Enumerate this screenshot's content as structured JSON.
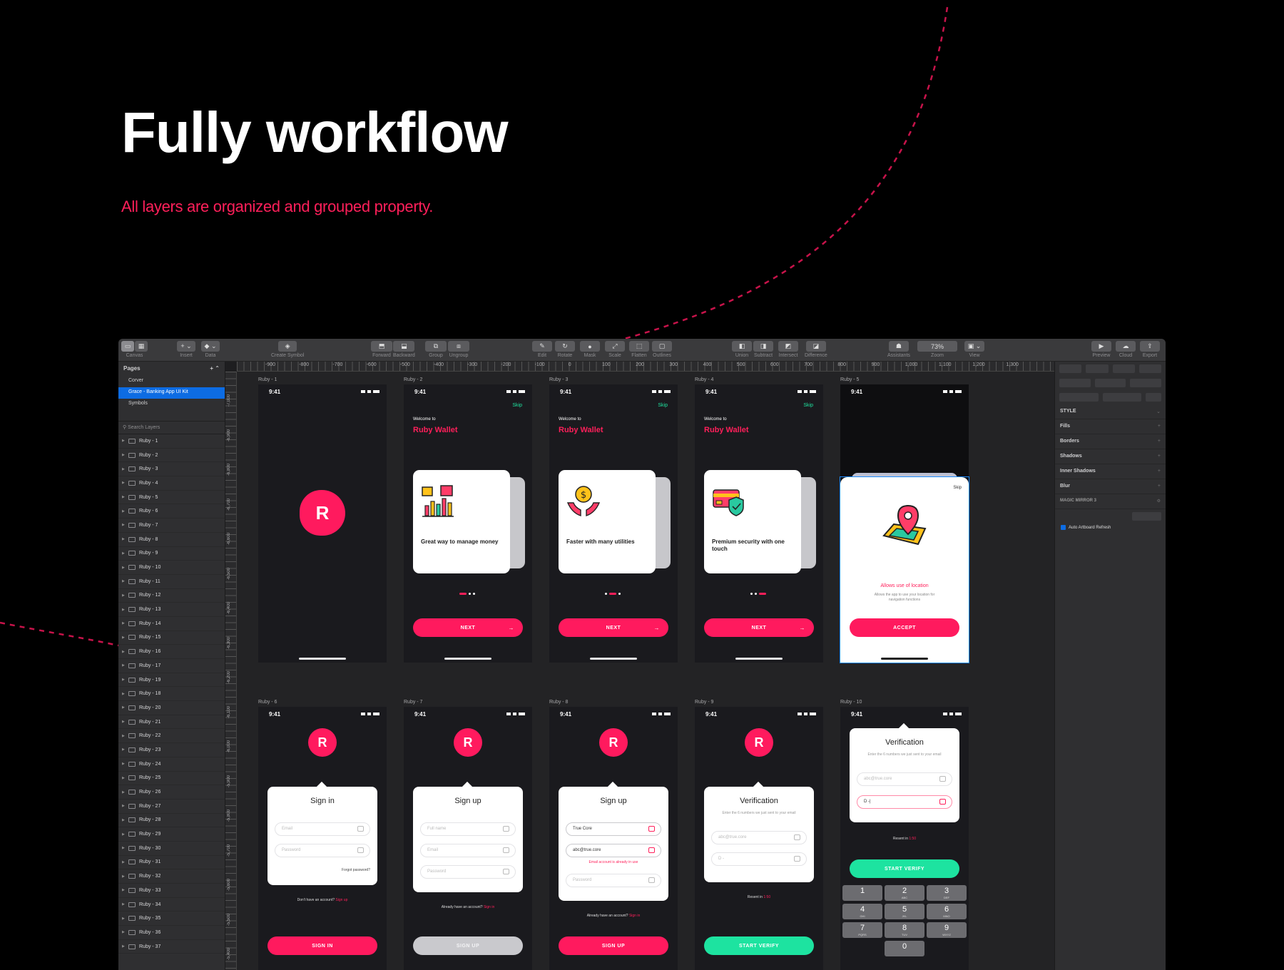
{
  "hero": {
    "title": "Fully workflow",
    "subtitle": "All layers are  organized and grouped property."
  },
  "colors": {
    "accent": "#ff1f5a",
    "green": "#1de3a0",
    "selection": "#0d6ce3"
  },
  "toolbar": {
    "canvas": "Canvas",
    "insert": "Insert",
    "data": "Data",
    "create_symbol": "Create Symbol",
    "forward": "Forward",
    "backward": "Backward",
    "group": "Group",
    "ungroup": "Ungroup",
    "edit": "Edit",
    "rotate": "Rotate",
    "mask": "Mask",
    "scale": "Scale",
    "flatten": "Flatten",
    "outlines": "Outlines",
    "union": "Union",
    "subtract": "Subtract",
    "intersect": "Intersect",
    "difference": "Difference",
    "assistants": "Assistants",
    "zoom_value": "73%",
    "zoom": "Zoom",
    "view": "View",
    "preview": "Preview",
    "cloud": "Cloud",
    "export": "Export"
  },
  "pages": {
    "header": "Pages",
    "items": [
      "Corver",
      "Grace - Banking App UI Kit",
      "Symbols"
    ],
    "selected": 1
  },
  "layers": {
    "search_placeholder": "Search Layers",
    "items": [
      "Ruby - 1",
      "Ruby - 2",
      "Ruby - 3",
      "Ruby - 4",
      "Ruby - 5",
      "Ruby - 6",
      "Ruby - 7",
      "Ruby - 8",
      "Ruby - 9",
      "Ruby - 10",
      "Ruby - 11",
      "Ruby - 12",
      "Ruby - 13",
      "Ruby - 14",
      "Ruby - 15",
      "Ruby - 16",
      "Ruby - 17",
      "Ruby - 19",
      "Ruby - 18",
      "Ruby - 20",
      "Ruby - 21",
      "Ruby - 22",
      "Ruby - 23",
      "Ruby - 24",
      "Ruby - 25",
      "Ruby - 26",
      "Ruby - 27",
      "Ruby - 28",
      "Ruby - 29",
      "Ruby - 30",
      "Ruby - 31",
      "Ruby - 32",
      "Ruby - 33",
      "Ruby - 34",
      "Ruby - 35",
      "Ruby - 36",
      "Ruby - 37"
    ]
  },
  "ruler": {
    "h": [
      "-900",
      "-800",
      "-700",
      "-600",
      "-500",
      "-400",
      "-300",
      "-200",
      "-100",
      "0",
      "100",
      "200",
      "300",
      "400",
      "500",
      "600",
      "700",
      "800",
      "900",
      "1,000",
      "1,100",
      "1,200",
      "1,300"
    ],
    "v": [
      "-7,000",
      "-6,900",
      "-6,800",
      "-6,700",
      "-6,600",
      "-6,500",
      "-6,400",
      "-6,300",
      "-6,200",
      "-6,100",
      "-6,000",
      "-5,900",
      "-5,800",
      "-5,700",
      "-5,600",
      "-5,500",
      "-5,400"
    ]
  },
  "inspector": {
    "style": "STYLE",
    "fills": "Fills",
    "borders": "Borders",
    "shadows": "Shadows",
    "inner_shadows": "Inner Shadows",
    "blur": "Blur",
    "magic_mirror": "MAGIC MIRROR 3",
    "auto_refresh": "Auto Artboard Refresh"
  },
  "artboards": {
    "r1": {
      "name": "Ruby - 1",
      "time": "9:41",
      "logo": "R"
    },
    "r2": {
      "name": "Ruby - 2",
      "time": "9:41",
      "skip": "Skip",
      "welcome": "Welcome to",
      "brand": "Ruby Wallet",
      "card": "Great way to manage money",
      "button": "NEXT",
      "arrow": "→"
    },
    "r3": {
      "name": "Ruby - 3",
      "time": "9:41",
      "skip": "Skip",
      "welcome": "Welcome to",
      "brand": "Ruby Wallet",
      "card": "Faster with many utilities",
      "button": "NEXT",
      "arrow": "→"
    },
    "r4": {
      "name": "Ruby - 4",
      "time": "9:41",
      "skip": "Skip",
      "welcome": "Welcome to",
      "brand": "Ruby Wallet",
      "card": "Premium security with one touch",
      "button": "NEXT",
      "arrow": "→"
    },
    "r5": {
      "name": "Ruby - 5",
      "time": "9:41",
      "skip": "Skip",
      "title": "Allows use of location",
      "desc": "Allows the app to use your location for navigation functions",
      "button": "ACCEPT"
    },
    "r6": {
      "name": "Ruby - 6",
      "time": "9:41",
      "logo": "R",
      "title": "Sign in",
      "email": "Email",
      "password": "Password",
      "forgot": "Forgot password?",
      "prompt": "Don't have an account?",
      "link": "Sign up",
      "button": "SIGN IN"
    },
    "r7": {
      "name": "Ruby - 7",
      "time": "9:41",
      "logo": "R",
      "title": "Sign up",
      "fullname": "Full name",
      "email": "Email",
      "password": "Password",
      "prompt": "Already have an account?",
      "link": "Sign in",
      "button": "SIGN UP"
    },
    "r8": {
      "name": "Ruby - 8",
      "time": "9:41",
      "logo": "R",
      "title": "Sign up",
      "fullname": "True Core",
      "email": "abc@true.core",
      "error": "Email account is already in use",
      "password": "Password",
      "prompt": "Already have an account?",
      "link": "Sign in",
      "button": "SIGN UP"
    },
    "r9": {
      "name": "Ruby - 9",
      "time": "9:41",
      "logo": "R",
      "title": "Verification",
      "desc": "Enter the 6 numbers we just sent to your email",
      "email": "abc@true.core",
      "code": "D -",
      "resend": "Resent in",
      "timer": "1:50",
      "button": "START VERIFY"
    },
    "r10": {
      "name": "Ruby - 10",
      "time": "9:41",
      "title": "Verification",
      "desc": "Enter the 6 numbers we just sent to your email",
      "email": "abc@true.core",
      "code": "D -|",
      "resend": "Resent in",
      "timer": "1:50",
      "button": "START VERIFY",
      "keys": [
        [
          "1",
          ""
        ],
        [
          "2",
          "ABC"
        ],
        [
          "3",
          "DEF"
        ],
        [
          "4",
          "GHI"
        ],
        [
          "5",
          "JKL"
        ],
        [
          "6",
          "MNO"
        ],
        [
          "7",
          "PQRS"
        ],
        [
          "8",
          "TUV"
        ],
        [
          "9",
          "WXYZ"
        ],
        [
          "0",
          ""
        ]
      ]
    }
  }
}
